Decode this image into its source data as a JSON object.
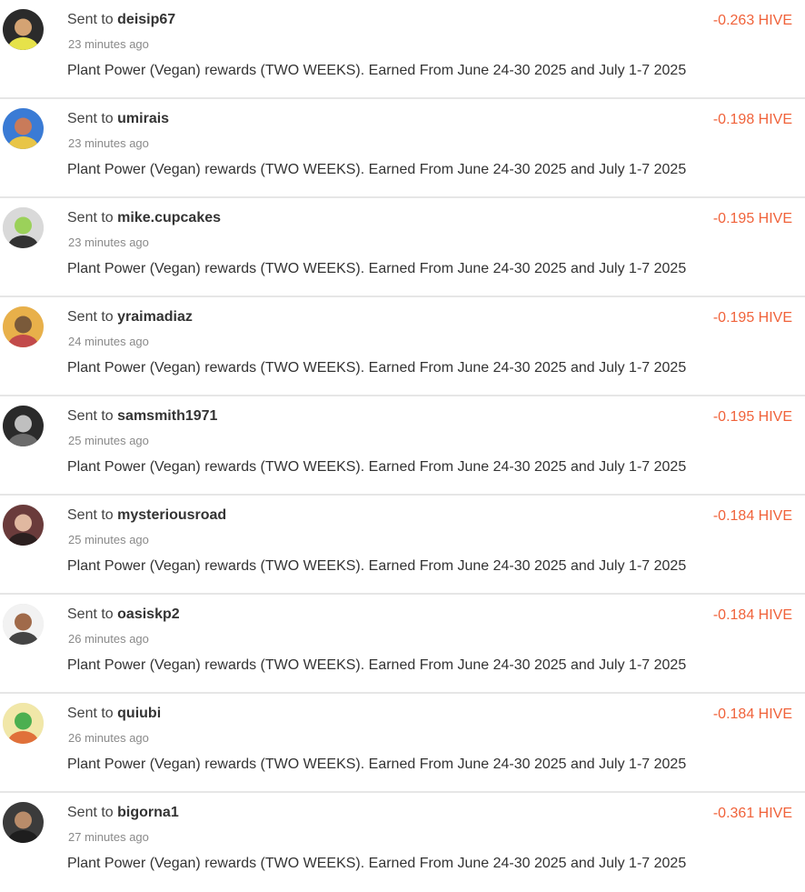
{
  "transfers": [
    {
      "prefix": "Sent to",
      "recipient": "deisip67",
      "time": "23 minutes ago",
      "memo": "Plant Power (Vegan) rewards (TWO WEEKS). Earned From June 24-30 2025 and July 1-7 2025",
      "amount": "-0.263 HIVE",
      "avatar_colors": [
        "#2b2b2b",
        "#d4a373",
        "#e6e24a"
      ]
    },
    {
      "prefix": "Sent to",
      "recipient": "umirais",
      "time": "23 minutes ago",
      "memo": "Plant Power (Vegan) rewards (TWO WEEKS). Earned From June 24-30 2025 and July 1-7 2025",
      "amount": "-0.198 HIVE",
      "avatar_colors": [
        "#3a7bd5",
        "#c97b5a",
        "#e8c547"
      ]
    },
    {
      "prefix": "Sent to",
      "recipient": "mike.cupcakes",
      "time": "23 minutes ago",
      "memo": "Plant Power (Vegan) rewards (TWO WEEKS). Earned From June 24-30 2025 and July 1-7 2025",
      "amount": "-0.195 HIVE",
      "avatar_colors": [
        "#d9d9d9",
        "#9bd15a",
        "#333333"
      ]
    },
    {
      "prefix": "Sent to",
      "recipient": "yraimadiaz",
      "time": "24 minutes ago",
      "memo": "Plant Power (Vegan) rewards (TWO WEEKS). Earned From June 24-30 2025 and July 1-7 2025",
      "amount": "-0.195 HIVE",
      "avatar_colors": [
        "#e8b04a",
        "#7a5a3a",
        "#c24a4a"
      ]
    },
    {
      "prefix": "Sent to",
      "recipient": "samsmith1971",
      "time": "25 minutes ago",
      "memo": "Plant Power (Vegan) rewards (TWO WEEKS). Earned From June 24-30 2025 and July 1-7 2025",
      "amount": "-0.195 HIVE",
      "avatar_colors": [
        "#2a2a2a",
        "#bfbfbf",
        "#6b6b6b"
      ]
    },
    {
      "prefix": "Sent to",
      "recipient": "mysteriousroad",
      "time": "25 minutes ago",
      "memo": "Plant Power (Vegan) rewards (TWO WEEKS). Earned From June 24-30 2025 and July 1-7 2025",
      "amount": "-0.184 HIVE",
      "avatar_colors": [
        "#6a3b3b",
        "#e0b8a0",
        "#2b1f1f"
      ]
    },
    {
      "prefix": "Sent to",
      "recipient": "oasiskp2",
      "time": "26 minutes ago",
      "memo": "Plant Power (Vegan) rewards (TWO WEEKS). Earned From June 24-30 2025 and July 1-7 2025",
      "amount": "-0.184 HIVE",
      "avatar_colors": [
        "#f2f2f2",
        "#a06a4a",
        "#444444"
      ]
    },
    {
      "prefix": "Sent to",
      "recipient": "quiubi",
      "time": "26 minutes ago",
      "memo": "Plant Power (Vegan) rewards (TWO WEEKS). Earned From June 24-30 2025 and July 1-7 2025",
      "amount": "-0.184 HIVE",
      "avatar_colors": [
        "#f1e7a8",
        "#4caf50",
        "#e0703a"
      ]
    },
    {
      "prefix": "Sent to",
      "recipient": "bigorna1",
      "time": "27 minutes ago",
      "memo": "Plant Power (Vegan) rewards (TWO WEEKS). Earned From June 24-30 2025 and July 1-7 2025",
      "amount": "-0.361 HIVE",
      "avatar_colors": [
        "#3b3b3b",
        "#b98c6a",
        "#1e1e1e"
      ]
    }
  ],
  "colors": {
    "amount": "#f0623a",
    "divider": "#e6e6e6",
    "text": "#333333",
    "time": "#8a8a8a"
  },
  "icons": {
    "avatar": "user-avatar-image"
  }
}
